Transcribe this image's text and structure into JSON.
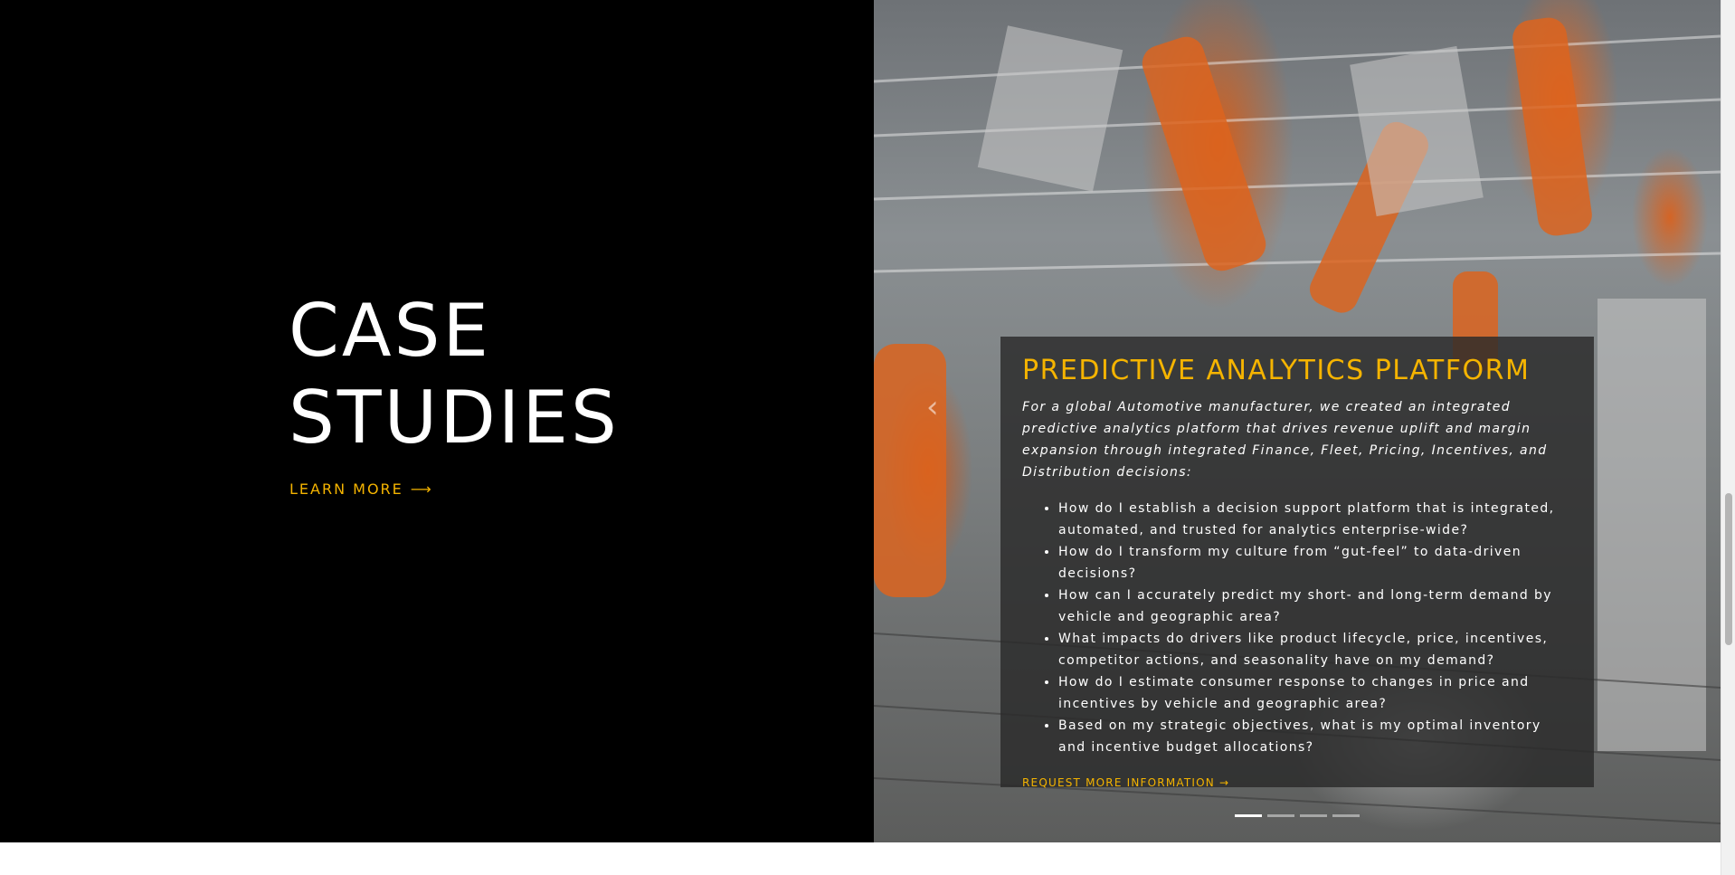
{
  "hero": {
    "title_line1": "CASE",
    "title_line2": "STUDIES",
    "learn_more_label": "LEARN MORE",
    "learn_more_arrow": "⟶"
  },
  "slider": {
    "prev_arrow": "‹",
    "card": {
      "title": "PREDICTIVE ANALYTICS PLATFORM",
      "intro": "For a global Automotive manufacturer, we created an integrated predictive analytics platform that drives revenue uplift and margin expansion through integrated Finance, Fleet, Pricing, Incentives, and Distribution decisions:",
      "questions": [
        "How do I establish a decision support platform that is integrated, automated, and trusted for analytics enterprise-wide?",
        "How do I transform my culture from “gut-feel” to data-driven decisions?",
        "How can I accurately predict my short- and long-term demand by vehicle and geographic area?",
        "What impacts do drivers like product lifecycle, price, incentives, competitor actions, and seasonality have on my demand?",
        "How do I estimate consumer response to changes in price and incentives by vehicle and geographic area?",
        "Based on my strategic objectives, what is my optimal inventory and incentive budget allocations?"
      ],
      "cta_label": "REQUEST MORE INFORMATION →"
    },
    "slide_count": 4,
    "active_slide": 1
  },
  "colors": {
    "accent": "#f5b400",
    "background_left": "#000000",
    "card_overlay": "#2a2a2a"
  }
}
